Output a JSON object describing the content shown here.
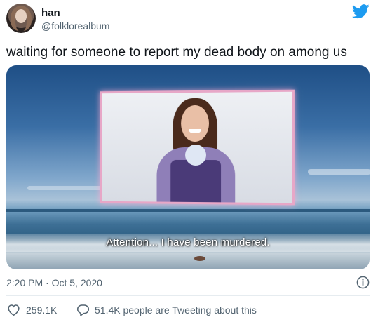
{
  "user": {
    "display_name": "han",
    "handle": "@folklorealbum"
  },
  "tweet": {
    "text": "waiting for someone to report my dead body on among us",
    "media": {
      "subtitle": "Attention... I have been murdered."
    },
    "timestamp": "2:20 PM · Oct 5, 2020"
  },
  "actions": {
    "likes": "259.1K",
    "people_tweeting": "51.4K people are Tweeting about this"
  },
  "icons": {
    "brand": "twitter-bird-icon",
    "info": "info-icon",
    "like": "heart-icon",
    "reply": "speech-bubble-icon"
  },
  "colors": {
    "brand_blue": "#1d9bf0",
    "secondary_text": "#536471",
    "primary_text": "#0f1419"
  }
}
